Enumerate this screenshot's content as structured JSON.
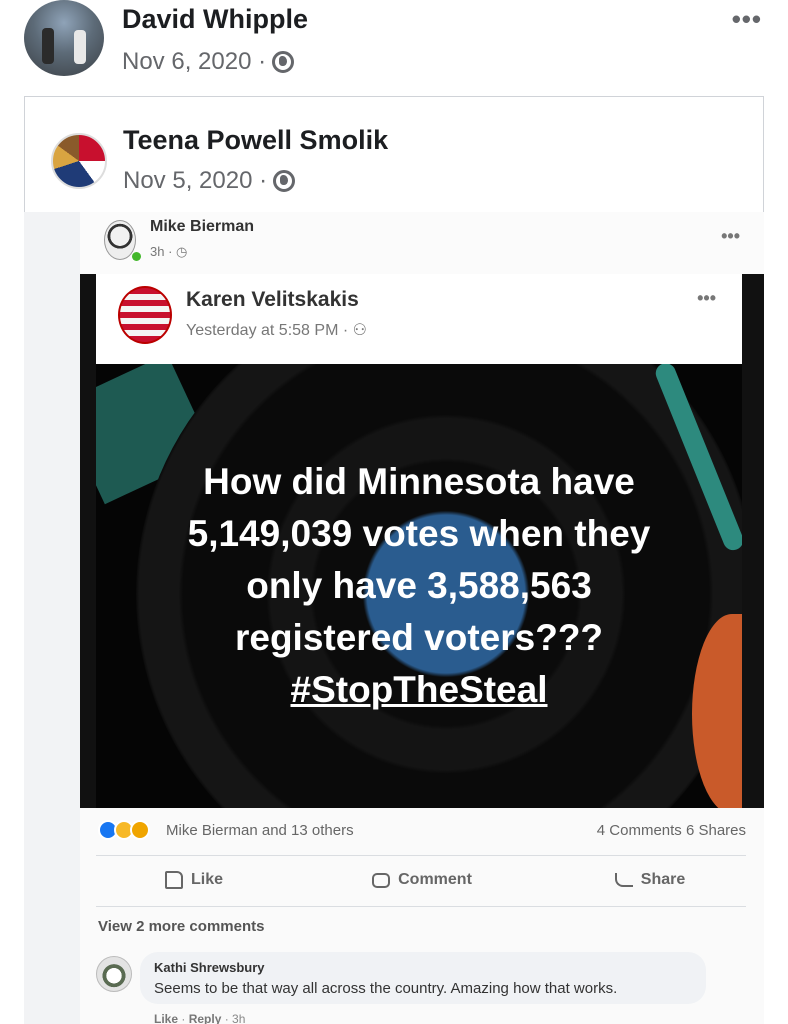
{
  "outer_post": {
    "author": "David Whipple",
    "date": "Nov 6, 2020 ·",
    "privacy_icon": "globe-icon",
    "more": "•••"
  },
  "shared_post": {
    "author": "Teena Powell Smolik",
    "date": "Nov 5, 2020 ·",
    "privacy_icon": "globe-icon"
  },
  "screenshot": {
    "reposter": {
      "name": "Mike Bierman",
      "time": "3h · ◷",
      "more": "•••"
    },
    "original": {
      "name": "Karen Velitskakis",
      "time": "Yesterday at 5:58 PM · ⚇",
      "more": "•••"
    },
    "meme": {
      "line1": "How did Minnesota have",
      "line2": "5,149,039 votes when they",
      "line3": "only have 3,588,563",
      "line4": "registered voters???",
      "hashtag": "#StopTheSteal"
    },
    "stats": {
      "reacted_by": "Mike Bierman and 13 others",
      "counts": "4 Comments  6 Shares"
    },
    "actions": {
      "like": "Like",
      "comment": "Comment",
      "share": "Share"
    },
    "view_more": "View 2 more comments",
    "comment": {
      "author": "Kathi Shrewsbury",
      "text": "Seems to be that way all across the country. Amazing how that works.",
      "like": "Like",
      "reply": "Reply",
      "time": "3h"
    }
  },
  "colors": {
    "facebook_blue": "#1877f2",
    "meta_gray": "#65676b",
    "meme_background": "#050505"
  }
}
